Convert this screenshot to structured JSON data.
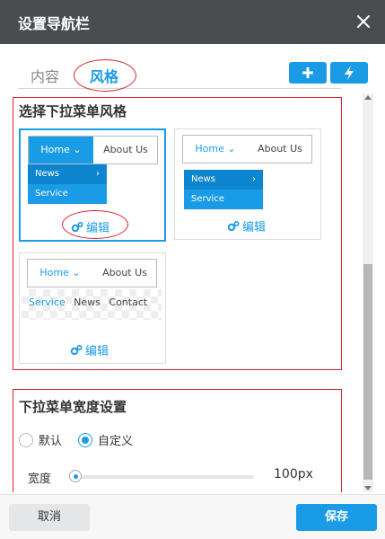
{
  "dialog": {
    "title": "设置导航栏"
  },
  "tabs": [
    {
      "label": "内容",
      "active": false
    },
    {
      "label": "风格",
      "active": true
    }
  ],
  "toolbar": {
    "add_icon": "plus-icon",
    "action_icon": "lightning-icon"
  },
  "style_section": {
    "title": "选择下拉菜单风格",
    "cards": [
      {
        "home": "Home",
        "about": "About Us",
        "items": [
          "News",
          "Service"
        ],
        "edit": "编辑",
        "selected": true
      },
      {
        "home": "Home",
        "about": "About Us",
        "items": [
          "News",
          "Service"
        ],
        "edit": "编辑",
        "selected": false
      },
      {
        "home": "Home",
        "about": "About Us",
        "flat_items": [
          "Service",
          "News",
          "Contact"
        ],
        "edit": "编辑",
        "selected": false
      }
    ]
  },
  "width_section": {
    "title": "下拉菜单宽度设置",
    "options": [
      {
        "label": "默认",
        "checked": false
      },
      {
        "label": "自定义",
        "checked": true
      }
    ],
    "slider_label": "宽度",
    "slider_value": "100px",
    "slider_level": 0.0
  },
  "footer": {
    "cancel": "取消",
    "save": "保存"
  },
  "colors": {
    "accent": "#1a9be6",
    "header": "#4a4c50",
    "annotation": "#d9262e"
  }
}
